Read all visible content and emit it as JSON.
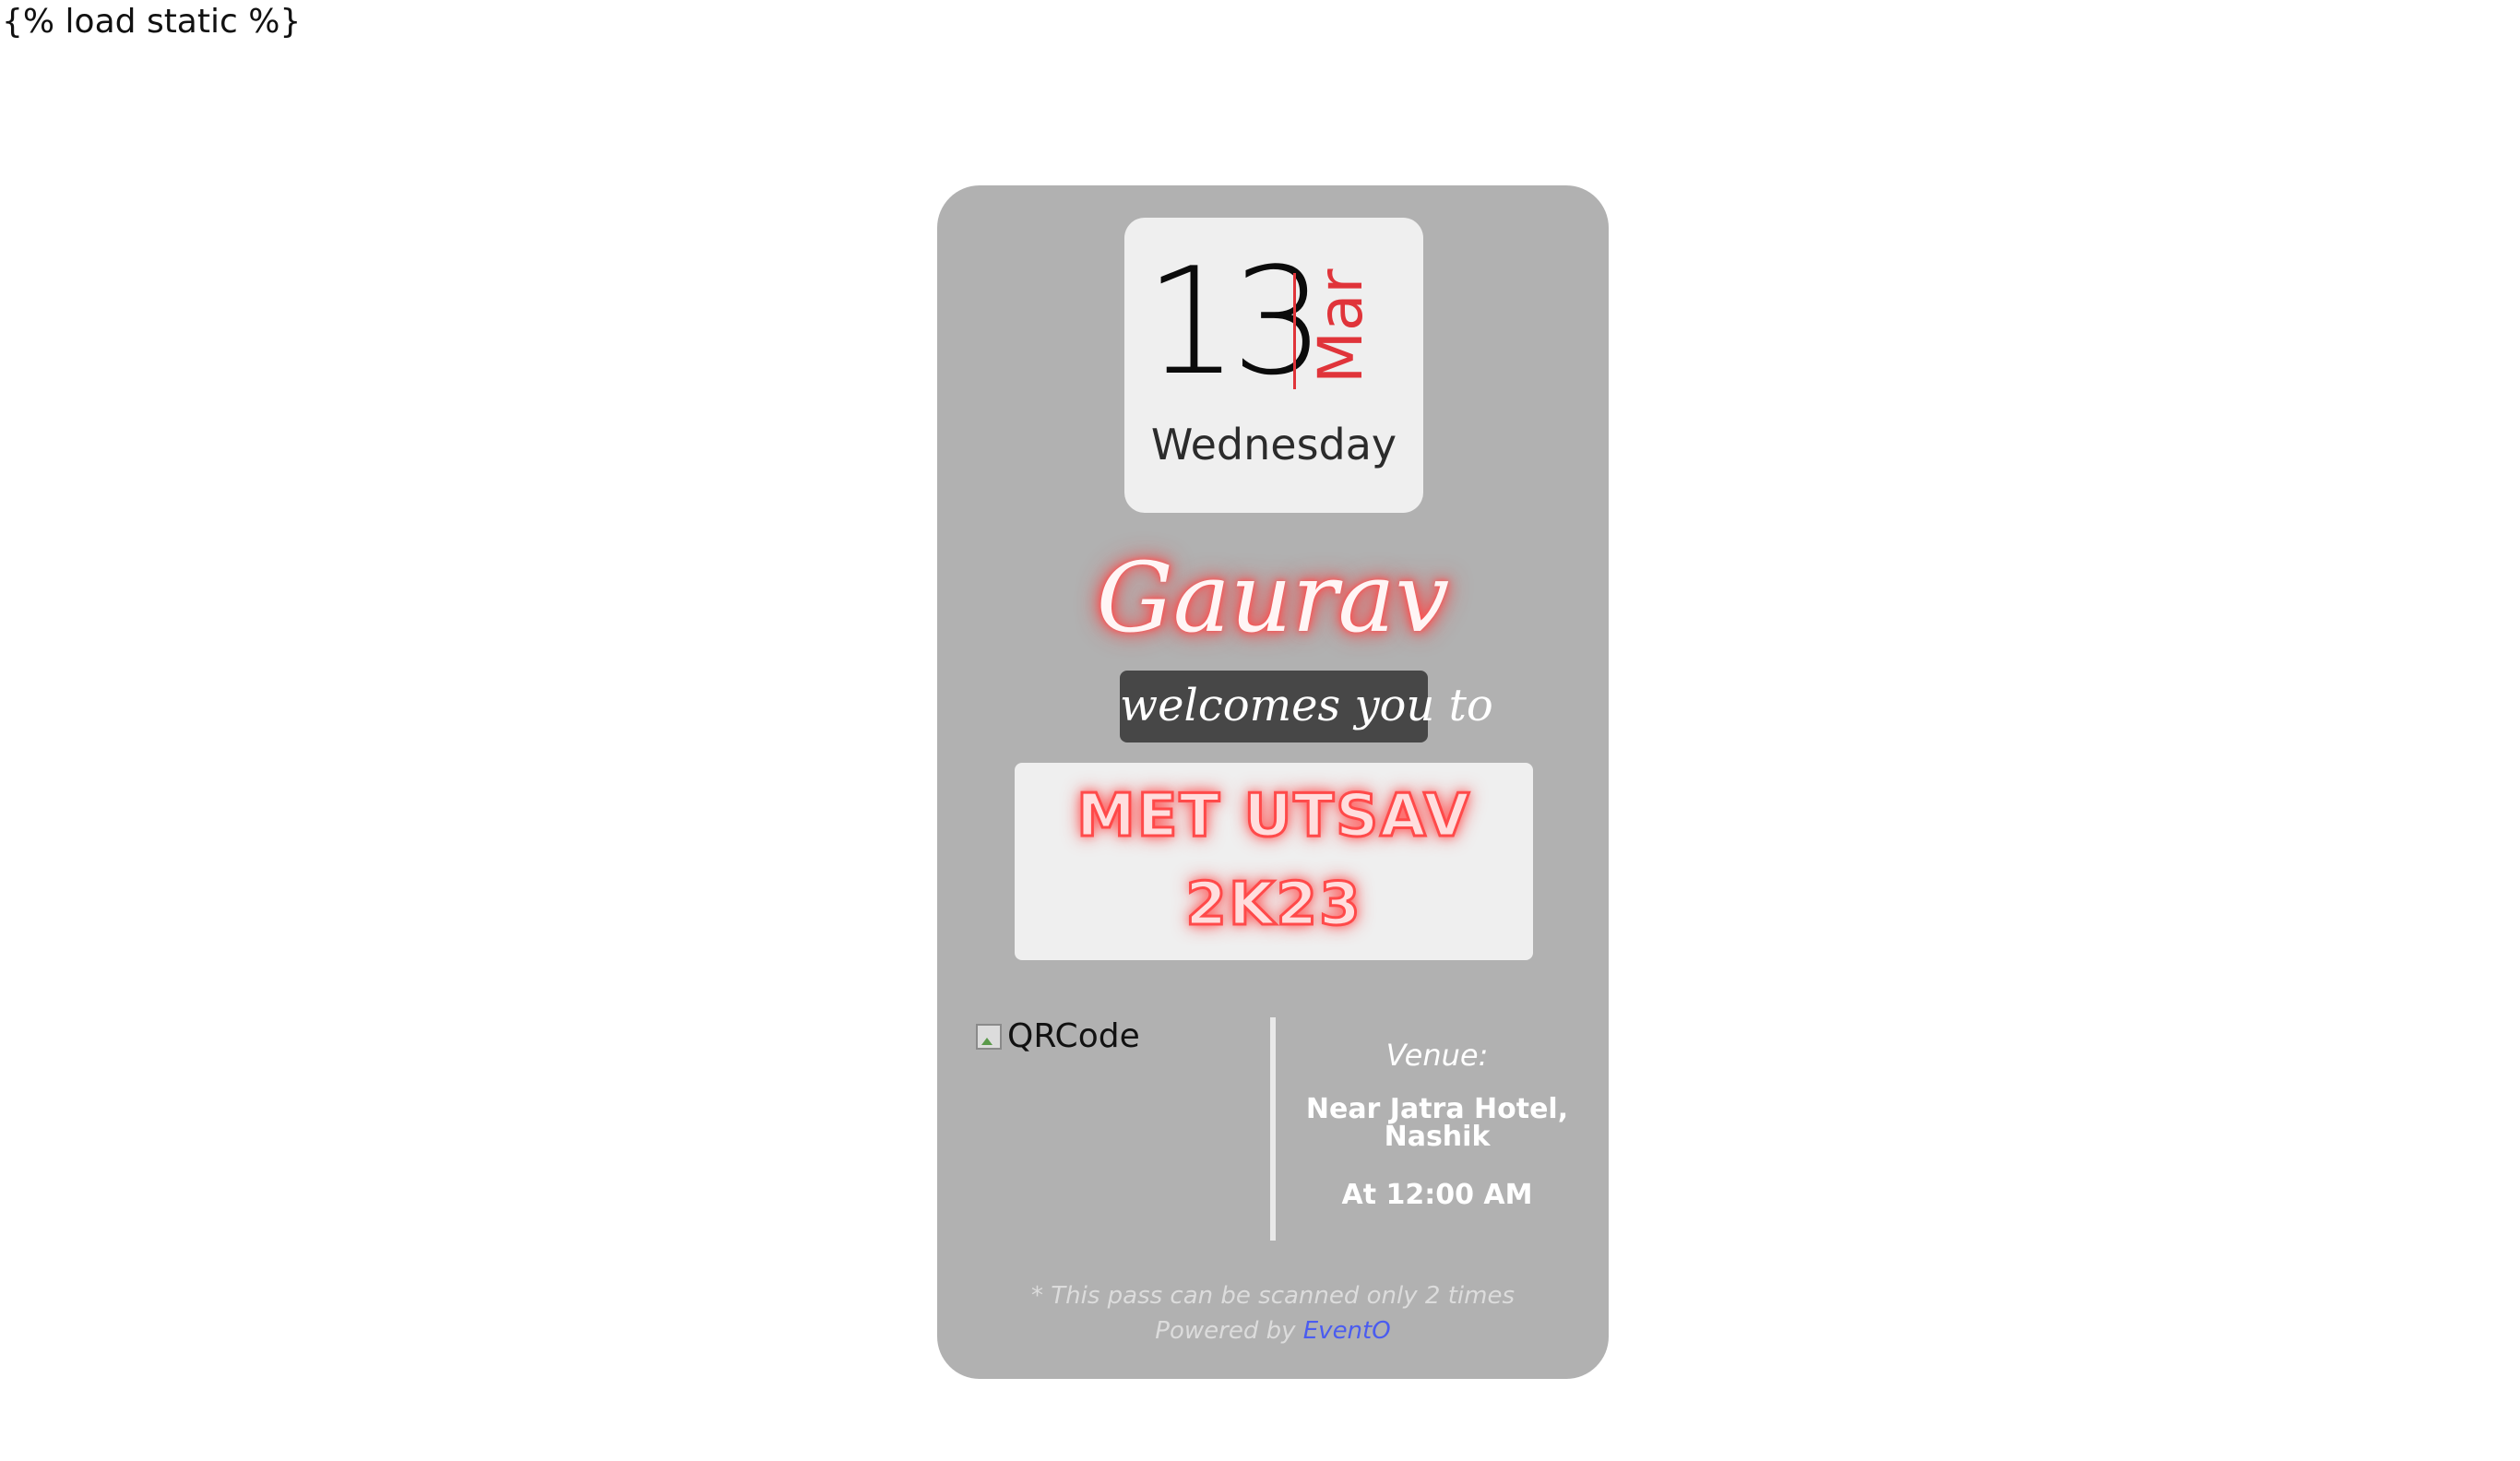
{
  "page": {
    "template_tag": "{% load static %}"
  },
  "date": {
    "day": "13",
    "month": "Mar",
    "weekday": "Wednesday"
  },
  "invite": {
    "host": "Gaurav",
    "welcome_text": "welcomes you to"
  },
  "event": {
    "name_line1": "MET UTSAV",
    "name_line2": "2K23"
  },
  "qr": {
    "alt_text": "QRCode",
    "icon": "broken-image-icon"
  },
  "venue": {
    "label": "Venue:",
    "address": "Near Jatra Hotel, Nashik",
    "time": "At 12:00 AM"
  },
  "footer": {
    "scan_note": "* This pass can be scanned only 2 times",
    "powered_prefix": "Powered by",
    "brand": "EventO"
  },
  "colors": {
    "card_background": "#b1b1b1",
    "accent_red": "#e0343a",
    "badge_dark": "#474747",
    "brand_blue": "#4a5cf0"
  }
}
